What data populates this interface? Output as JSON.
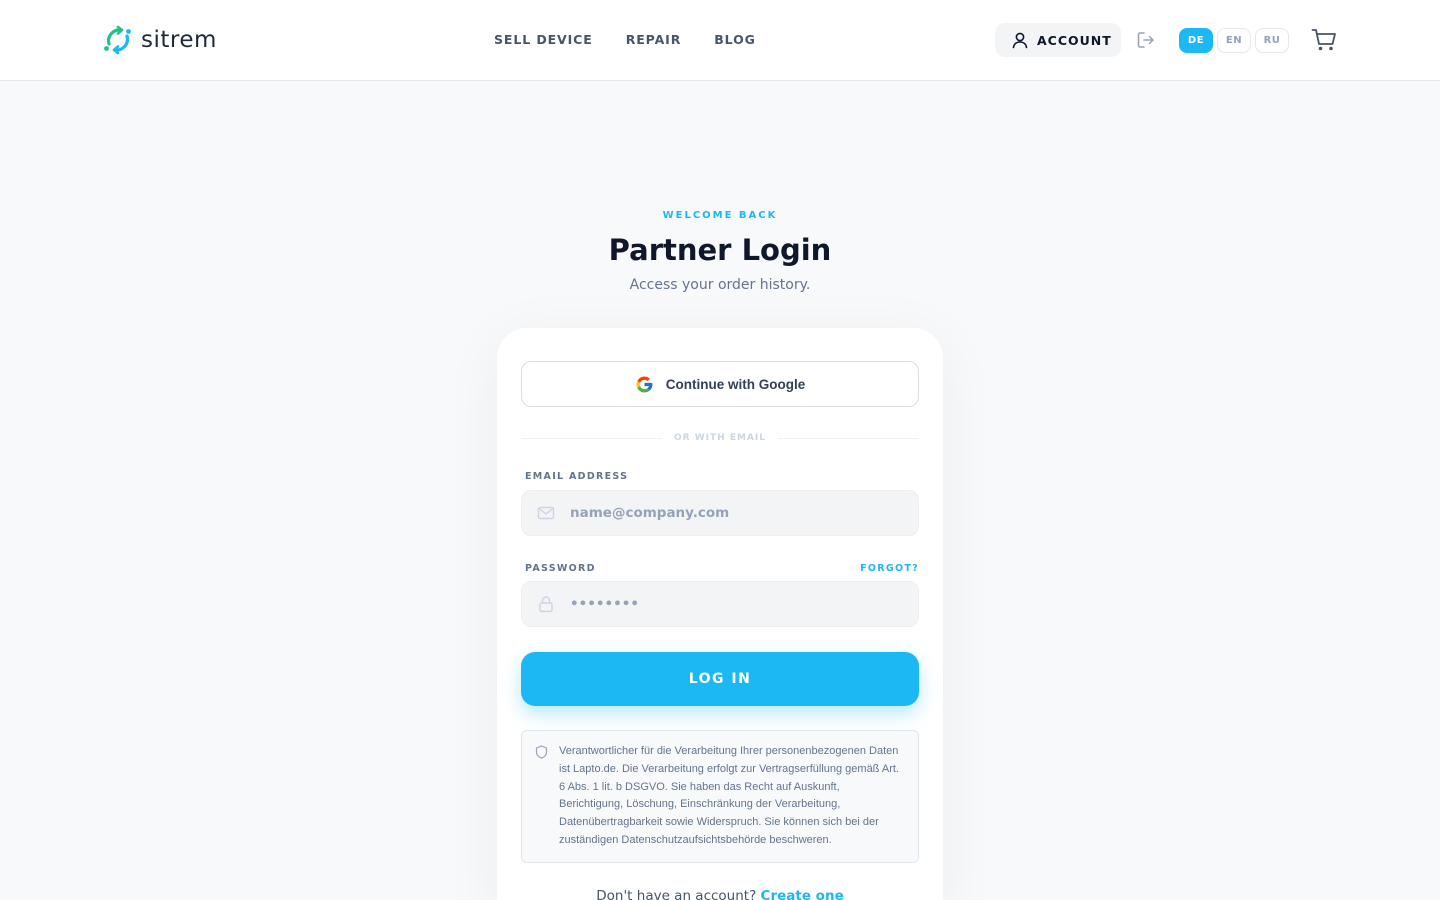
{
  "brand": {
    "name": "sitrem"
  },
  "nav": {
    "items": [
      "SELL DEVICE",
      "REPAIR",
      "BLOG"
    ]
  },
  "header": {
    "account_label": "ACCOUNT",
    "languages": [
      {
        "code": "DE",
        "active": true
      },
      {
        "code": "EN",
        "active": false
      },
      {
        "code": "RU",
        "active": false
      }
    ]
  },
  "login": {
    "eyebrow": "WELCOME BACK",
    "title": "Partner Login",
    "subtitle": "Access your order history.",
    "google_label": "Continue with Google",
    "divider": "OR WITH EMAIL",
    "email_label": "EMAIL ADDRESS",
    "email_placeholder": "name@company.com",
    "password_label": "PASSWORD",
    "forgot_label": "FORGOT?",
    "password_placeholder": "••••••••",
    "submit_label": "LOG IN",
    "privacy_text": "Verantwortlicher für die Verarbeitung Ihrer personenbezogenen Daten ist Lapto.de. Die Verarbeitung erfolgt zur Vertragserfüllung gemäß Art. 6 Abs. 1 lit. b DSGVO. Sie haben das Recht auf Auskunft, Berichtigung, Löschung, Einschränkung der Verarbeitung, Datenübertragbarkeit sowie Widerspruch. Sie können sich bei der zuständigen Datenschutzaufsichtsbehörde beschweren.",
    "signup_prompt": "Don't have an account?",
    "signup_link": "Create one"
  },
  "colors": {
    "accent": "#1cb8f3",
    "logo_green": "#22c08a",
    "logo_blue": "#1cb8f3",
    "heading": "#0f172a",
    "muted": "#64748b"
  },
  "icons": [
    "sitrem-logo",
    "user-icon",
    "logout-icon",
    "cart-icon",
    "google-icon",
    "mail-icon",
    "lock-icon",
    "shield-icon"
  ]
}
